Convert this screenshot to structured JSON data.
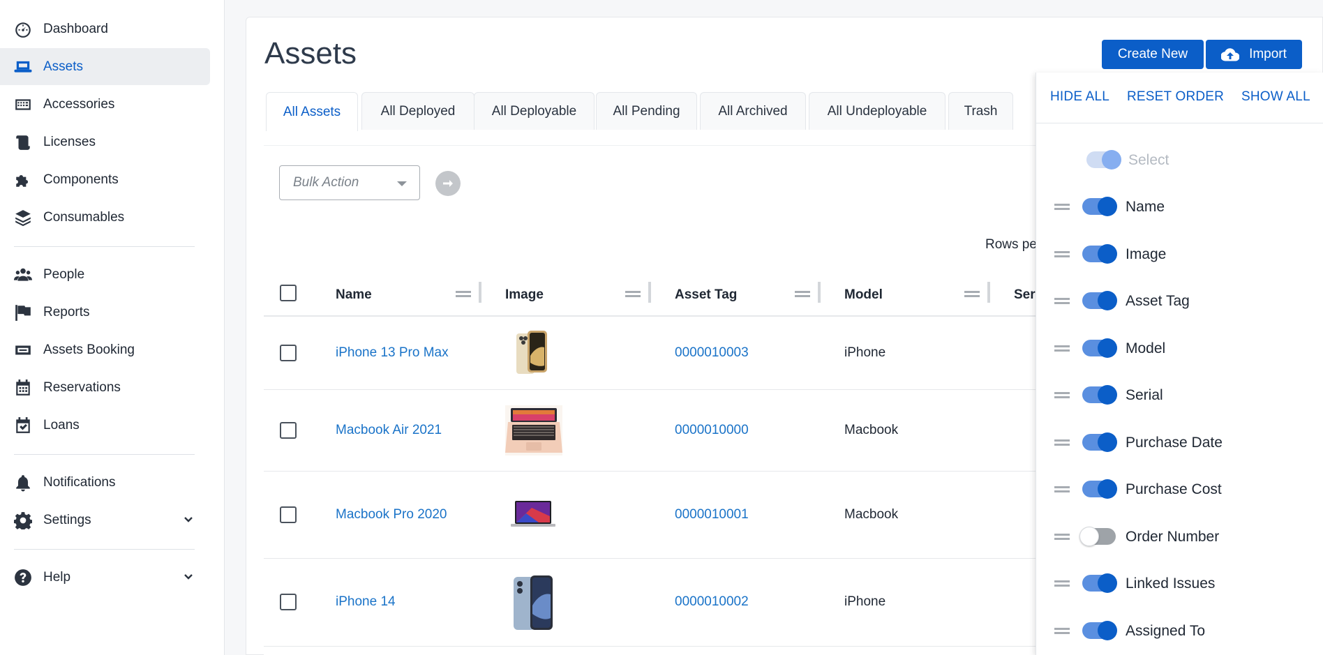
{
  "sidebar": {
    "items": [
      {
        "label": "Dashboard",
        "icon": "dashboard-icon"
      },
      {
        "label": "Assets",
        "icon": "laptop-icon",
        "active": true
      },
      {
        "label": "Accessories",
        "icon": "keyboard-icon"
      },
      {
        "label": "Licenses",
        "icon": "scroll-icon"
      },
      {
        "label": "Components",
        "icon": "puzzle-icon"
      },
      {
        "label": "Consumables",
        "icon": "layers-icon"
      },
      {
        "label": "People",
        "icon": "users-icon"
      },
      {
        "label": "Reports",
        "icon": "flag-icon"
      },
      {
        "label": "Assets Booking",
        "icon": "booking-icon"
      },
      {
        "label": "Reservations",
        "icon": "calendar-icon"
      },
      {
        "label": "Loans",
        "icon": "calendar-check-icon"
      },
      {
        "label": "Notifications",
        "icon": "bell-icon"
      },
      {
        "label": "Settings",
        "icon": "gear-icon"
      },
      {
        "label": "Help",
        "icon": "help-icon"
      }
    ]
  },
  "header": {
    "title": "Assets",
    "create_label": "Create New",
    "import_label": "Import"
  },
  "tabs": [
    "All Assets",
    "All Deployed",
    "All Deployable",
    "All Pending",
    "All Archived",
    "All Undeployable",
    "Trash"
  ],
  "toolbar": {
    "bulk_placeholder": "Bulk Action",
    "rows_per_page_label": "Rows pe"
  },
  "table": {
    "columns": [
      "Name",
      "Image",
      "Asset Tag",
      "Model",
      "Ser"
    ],
    "rows": [
      {
        "name": "iPhone 13 Pro Max",
        "asset_tag": "0000010003",
        "model": "iPhone",
        "image": "iphone-13-pro-max-thumbnail"
      },
      {
        "name": "Macbook Air 2021",
        "asset_tag": "0000010000",
        "model": "Macbook",
        "image": "macbook-air-thumbnail"
      },
      {
        "name": "Macbook Pro 2020",
        "asset_tag": "0000010001",
        "model": "Macbook",
        "image": "macbook-pro-thumbnail"
      },
      {
        "name": "iPhone 14",
        "asset_tag": "0000010002",
        "model": "iPhone",
        "image": "iphone-14-thumbnail"
      }
    ]
  },
  "column_chooser": {
    "hide_all": "HIDE ALL",
    "reset_order": "RESET ORDER",
    "show_all": "SHOW ALL",
    "columns": [
      {
        "label": "Select",
        "enabled": true,
        "disabled": true
      },
      {
        "label": "Name",
        "enabled": true
      },
      {
        "label": "Image",
        "enabled": true
      },
      {
        "label": "Asset Tag",
        "enabled": true
      },
      {
        "label": "Model",
        "enabled": true
      },
      {
        "label": "Serial",
        "enabled": true
      },
      {
        "label": "Purchase Date",
        "enabled": true
      },
      {
        "label": "Purchase Cost",
        "enabled": true
      },
      {
        "label": "Order Number",
        "enabled": false
      },
      {
        "label": "Linked Issues",
        "enabled": true
      },
      {
        "label": "Assigned To",
        "enabled": true
      }
    ]
  },
  "colors": {
    "accent": "#0b5ec8",
    "link": "#1a73c8",
    "sidebar_active_bg": "#eceef1"
  }
}
